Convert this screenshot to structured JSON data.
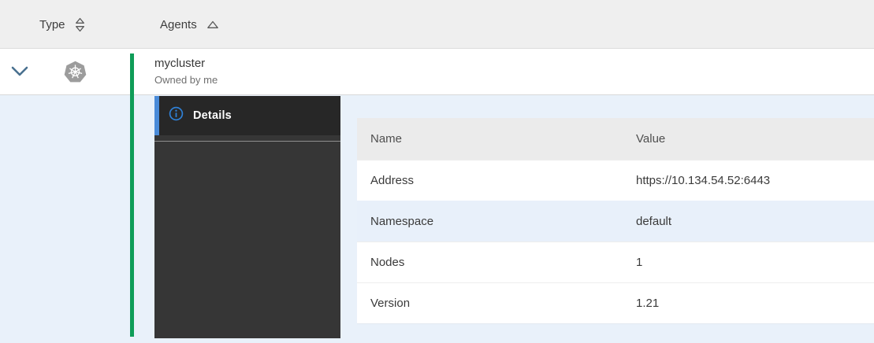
{
  "colors": {
    "accent_blue": "#4a8bd8",
    "info_icon_blue": "#2f80d6",
    "green_status_bar": "#0f9d58",
    "header_bg": "#efefef",
    "expanded_bg": "#e9f1fa",
    "panel_bg": "#363636",
    "active_tab_bg": "#272727",
    "tinted_row_bg": "#e8f0fa"
  },
  "header": {
    "columns": [
      {
        "label": "Type",
        "sort_state": "unsorted",
        "sort_icon": "sort-both-icon"
      },
      {
        "label": "Agents",
        "sort_state": "ascending",
        "sort_icon": "sort-asc-icon"
      }
    ]
  },
  "cluster_row": {
    "name": "mycluster",
    "owner": "Owned by me",
    "type_icon": "kubernetes-icon",
    "expander_icon": "chevron-down-icon",
    "expanded": true
  },
  "detail_panel": {
    "tabs": [
      {
        "label": "Details",
        "icon": "info-icon",
        "active": true
      }
    ]
  },
  "details_table": {
    "headers": {
      "name": "Name",
      "value": "Value"
    },
    "rows": [
      {
        "name": "Address",
        "value": "https://10.134.54.52:6443"
      },
      {
        "name": "Namespace",
        "value": "default"
      },
      {
        "name": "Nodes",
        "value": "1"
      },
      {
        "name": "Version",
        "value": "1.21"
      }
    ]
  }
}
